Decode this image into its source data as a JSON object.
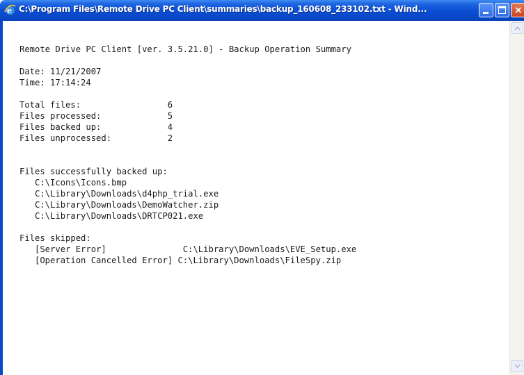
{
  "window": {
    "title": "C:\\Program Files\\Remote Drive PC Client\\summaries\\backup_160608_233102.txt - Wind...",
    "app_icon": "internet-explorer-e-icon",
    "buttons": [
      "minimize",
      "maximize",
      "close"
    ]
  },
  "document": {
    "text": "Remote Drive PC Client [ver. 3.5.21.0] - Backup Operation Summary\n\nDate: 11/21/2007\nTime: 17:14:24\n\nTotal files:                 6\nFiles processed:             5\nFiles backed up:             4\nFiles unprocessed:           2\n\n\nFiles successfully backed up:\n   C:\\Icons\\Icons.bmp\n   C:\\Library\\Downloads\\d4php_trial.exe\n   C:\\Library\\Downloads\\DemoWatcher.zip\n   C:\\Library\\Downloads\\DRTCP021.exe\n\nFiles skipped:\n   [Server Error]               C:\\Library\\Downloads\\EVE_Setup.exe\n   [Operation Cancelled Error] C:\\Library\\Downloads\\FileSpy.zip"
  },
  "colors": {
    "titlebar": "#0b4fd6",
    "close_button": "#c8451e"
  }
}
